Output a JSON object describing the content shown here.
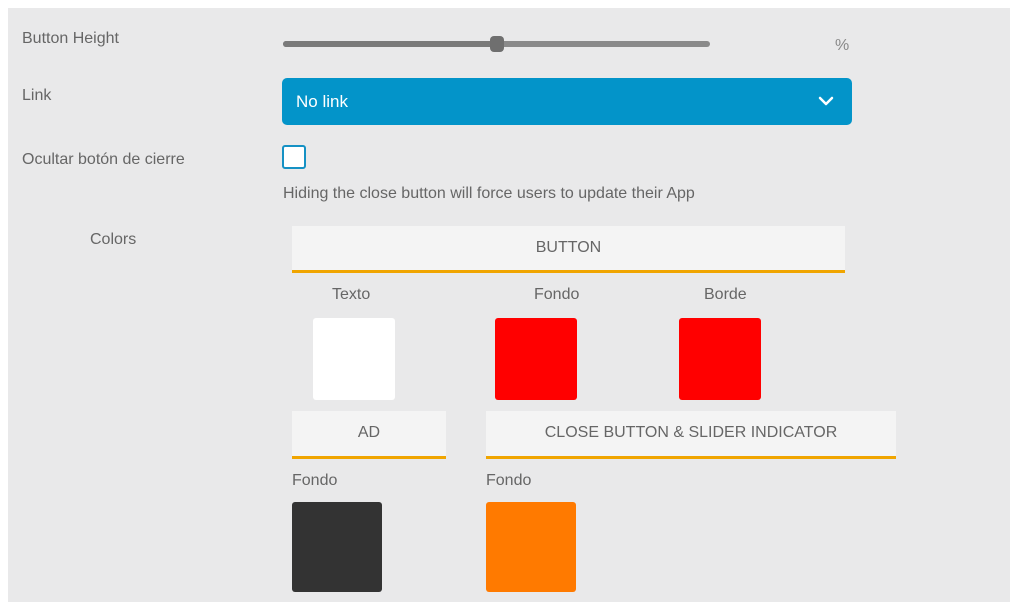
{
  "form": {
    "button_height": {
      "label": "Button Height",
      "unit": "%",
      "slider_fraction": 0.5
    },
    "link": {
      "label": "Link",
      "selected": "No link",
      "bg_color": "#0394c9"
    },
    "hide_close": {
      "label": "Ocultar botón de cierre",
      "checked": false,
      "hint": "Hiding the close button will force users to update their App"
    },
    "colors": {
      "label": "Colors",
      "accent_color": "#f0a500",
      "button_tab": {
        "title": "BUTTON",
        "swatches": [
          {
            "label": "Texto",
            "color": "#ffffff"
          },
          {
            "label": "Fondo",
            "color": "#ff0000"
          },
          {
            "label": "Borde",
            "color": "#ff0000"
          }
        ]
      },
      "ad_tab": {
        "title": "AD",
        "swatch": {
          "label": "Fondo",
          "color": "#333333"
        }
      },
      "close_tab": {
        "title": "CLOSE BUTTON & SLIDER INDICATOR",
        "swatch": {
          "label": "Fondo",
          "color": "#ff7a00"
        }
      }
    }
  }
}
